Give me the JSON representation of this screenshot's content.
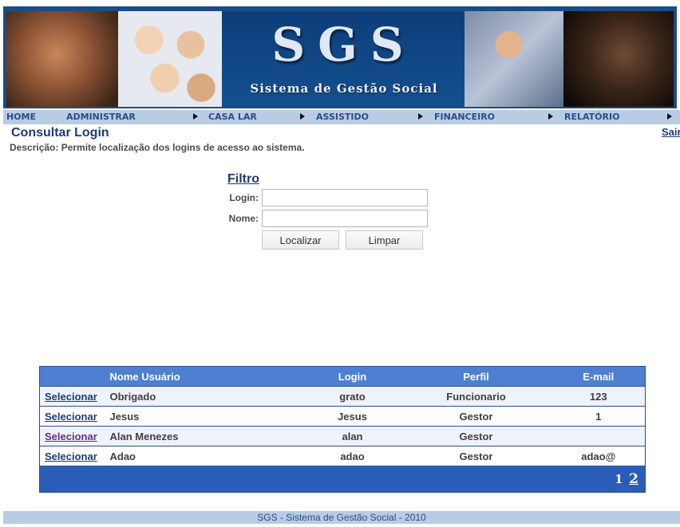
{
  "banner": {
    "logo_letters": "SGS",
    "logo_subtitle": "Sistema de Gestão Social"
  },
  "nav": {
    "items": [
      {
        "label": "HOME"
      },
      {
        "label": "ADMINISTRAR"
      },
      {
        "label": "CASA LAR"
      },
      {
        "label": "ASSISTIDO"
      },
      {
        "label": "FINANCEIRO"
      },
      {
        "label": "RELATÓRIO"
      }
    ]
  },
  "header": {
    "title": "Consultar Login",
    "description": "Descrição: Permite localização dos logins de acesso ao sistema.",
    "logout": "Sair"
  },
  "filter": {
    "title": "Filtro",
    "login_label": "Login:",
    "login_value": "",
    "name_label": "Nome:",
    "name_value": "",
    "search_button": "Localizar",
    "clear_button": "Limpar"
  },
  "grid": {
    "headers": [
      "",
      "Nome Usuário",
      "Login",
      "Perfil",
      "E-mail"
    ],
    "select_label": "Selecionar",
    "rows": [
      {
        "name": "Obrigado",
        "login": "grato",
        "perfil": "Funcionario",
        "email": "123"
      },
      {
        "name": "Jesus",
        "login": "Jesus",
        "perfil": "Gestor",
        "email": "1"
      },
      {
        "name": "Alan Menezes",
        "login": "alan",
        "perfil": "Gestor",
        "email": ""
      },
      {
        "name": "Adao",
        "login": "adao",
        "perfil": "Gestor",
        "email": "adao@"
      }
    ],
    "pager": {
      "current": "1",
      "next": "2"
    }
  },
  "footer": {
    "text": "SGS - Sistema de Gestão Social - 2010"
  },
  "colors": {
    "nav_bar": "#b8cce4",
    "grid_header": "#4f7fd0",
    "pager_bar": "#2a5db8",
    "title_blue": "#1d3b72"
  }
}
